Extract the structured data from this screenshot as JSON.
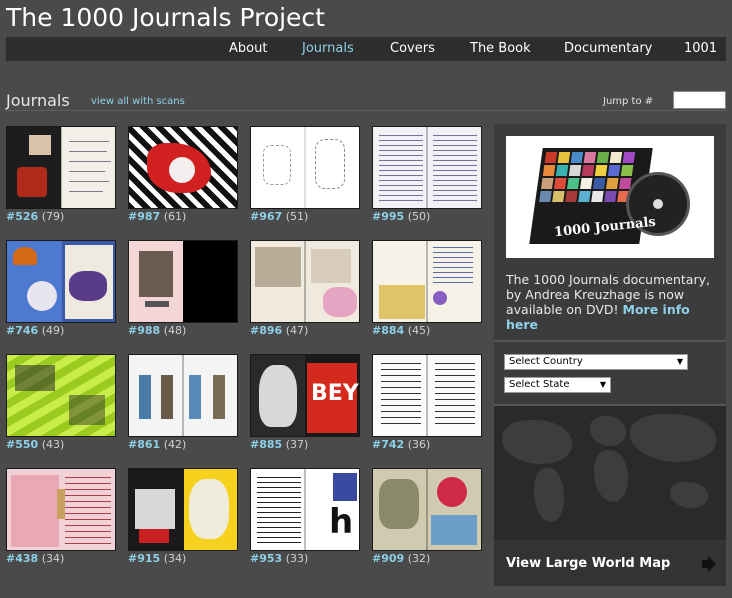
{
  "site": {
    "title": "The 1000 Journals Project"
  },
  "nav": {
    "items": [
      {
        "label": "About",
        "active": false
      },
      {
        "label": "Journals",
        "active": true
      },
      {
        "label": "Covers",
        "active": false
      },
      {
        "label": "The Book",
        "active": false
      },
      {
        "label": "Documentary",
        "active": false
      },
      {
        "label": "1001",
        "active": false
      }
    ]
  },
  "journals": {
    "heading": "Journals",
    "view_all_link": "view all with scans",
    "jump_label": "Jump to #",
    "jump_value": "",
    "tiles": [
      {
        "number": "#526",
        "count": "(79)"
      },
      {
        "number": "#987",
        "count": "(61)"
      },
      {
        "number": "#967",
        "count": "(51)"
      },
      {
        "number": "#995",
        "count": "(50)"
      },
      {
        "number": "#746",
        "count": "(49)"
      },
      {
        "number": "#988",
        "count": "(48)"
      },
      {
        "number": "#896",
        "count": "(47)"
      },
      {
        "number": "#884",
        "count": "(45)"
      },
      {
        "number": "#550",
        "count": "(43)"
      },
      {
        "number": "#861",
        "count": "(42)"
      },
      {
        "number": "#885",
        "count": "(37)"
      },
      {
        "number": "#742",
        "count": "(36)"
      },
      {
        "number": "#438",
        "count": "(34)"
      },
      {
        "number": "#915",
        "count": "(34)"
      },
      {
        "number": "#953",
        "count": "(33)"
      },
      {
        "number": "#909",
        "count": "(32)"
      }
    ]
  },
  "sidebar": {
    "dvd_cover_text": "1000 Journals",
    "promo_text": "The 1000 Journals documentary, by Andrea Kreuzhage is now available on DVD!",
    "promo_link": "More info here",
    "country_select": "Select Country",
    "state_select": "Select State",
    "map_link": "View Large World Map",
    "arrow_icon": "arrow-right-icon"
  },
  "colors": {
    "background": "#4a4a4a",
    "navbar": "#2d2d2d",
    "accent": "#8ed0e8",
    "sidebar": "#3c3c3c"
  }
}
